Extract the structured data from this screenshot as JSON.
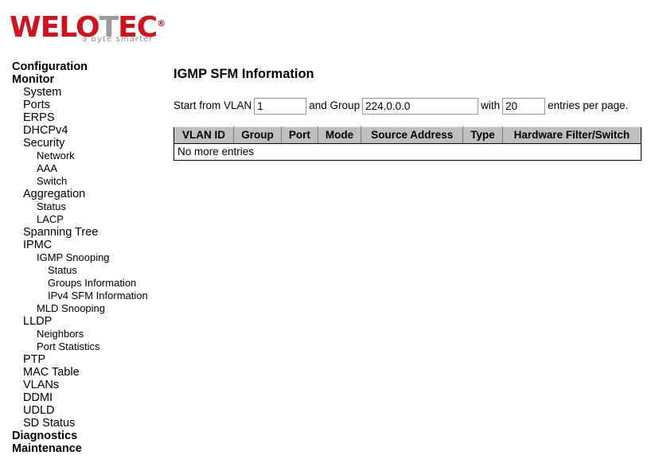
{
  "brand": {
    "name_part1": "WEL",
    "name_part2": "O",
    "name_gray_letter": "T",
    "name_part3": "EC",
    "registered_mark": "®",
    "tagline": "a byte smarter",
    "brand_color": "#d3101b",
    "gray_color": "#9a9a9a"
  },
  "sidebar": {
    "items": [
      {
        "label": "Configuration",
        "level": 0
      },
      {
        "label": "Monitor",
        "level": 0
      },
      {
        "label": "System",
        "level": 1
      },
      {
        "label": "Ports",
        "level": 1
      },
      {
        "label": "ERPS",
        "level": 1
      },
      {
        "label": "DHCPv4",
        "level": 1
      },
      {
        "label": "Security",
        "level": 1
      },
      {
        "label": "Network",
        "level": 2
      },
      {
        "label": "AAA",
        "level": 2
      },
      {
        "label": "Switch",
        "level": 2
      },
      {
        "label": "Aggregation",
        "level": 1
      },
      {
        "label": "Status",
        "level": 2
      },
      {
        "label": "LACP",
        "level": 2
      },
      {
        "label": "Spanning Tree",
        "level": 1
      },
      {
        "label": "IPMC",
        "level": 1
      },
      {
        "label": "IGMP Snooping",
        "level": 2
      },
      {
        "label": "Status",
        "level": 3
      },
      {
        "label": "Groups Information",
        "level": 3
      },
      {
        "label": "IPv4 SFM Information",
        "level": 3
      },
      {
        "label": "MLD Snooping",
        "level": 2
      },
      {
        "label": "LLDP",
        "level": 1
      },
      {
        "label": "Neighbors",
        "level": 2
      },
      {
        "label": "Port Statistics",
        "level": 2
      },
      {
        "label": "PTP",
        "level": 1
      },
      {
        "label": "MAC Table",
        "level": 1
      },
      {
        "label": "VLANs",
        "level": 1
      },
      {
        "label": "DDMI",
        "level": 1
      },
      {
        "label": "UDLD",
        "level": 1
      },
      {
        "label": "SD Status",
        "level": 1
      },
      {
        "label": "Diagnostics",
        "level": 0
      },
      {
        "label": "Maintenance",
        "level": 0
      }
    ]
  },
  "main": {
    "title": "IGMP SFM Information",
    "filter": {
      "label_start": "Start from VLAN",
      "vlan_value": "1",
      "label_and_group": "and Group",
      "group_value": "224.0.0.0",
      "label_with": "with",
      "entries_value": "20",
      "label_per_page": "entries per page."
    },
    "table": {
      "header_bg": "#bfbfbf",
      "columns": [
        "VLAN ID",
        "Group",
        "Port",
        "Mode",
        "Source Address",
        "Type",
        "Hardware Filter/Switch"
      ],
      "empty_message": "No more entries",
      "rows": []
    }
  }
}
